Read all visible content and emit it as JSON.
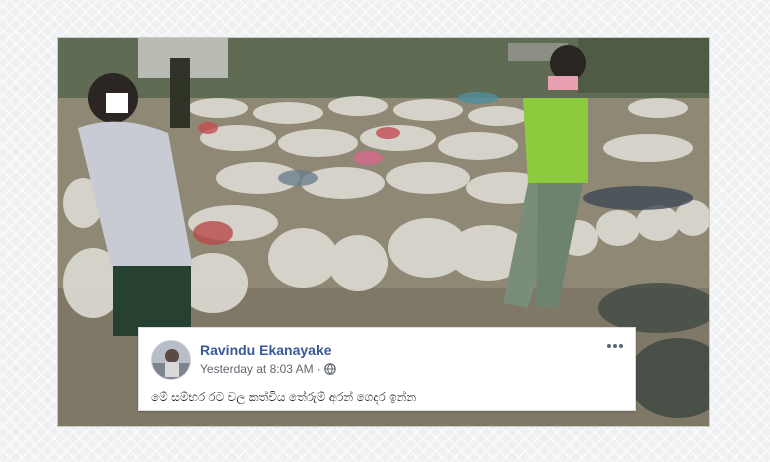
{
  "photo": {
    "description_icon": "photo-icon"
  },
  "post": {
    "author": "Ravindu Ekanayake",
    "timestamp": "Yesterday at 8:03 AM",
    "separator": "·",
    "privacy_icon": "globe-icon",
    "menu_icon": "more-options-icon",
    "text": "මේ සම්භර රට වල කත්විය තේරුම් අරන් ගෙදර ඉන්න"
  },
  "colors": {
    "author": "#385898",
    "meta": "#616770",
    "card_bg": "#ffffff"
  }
}
